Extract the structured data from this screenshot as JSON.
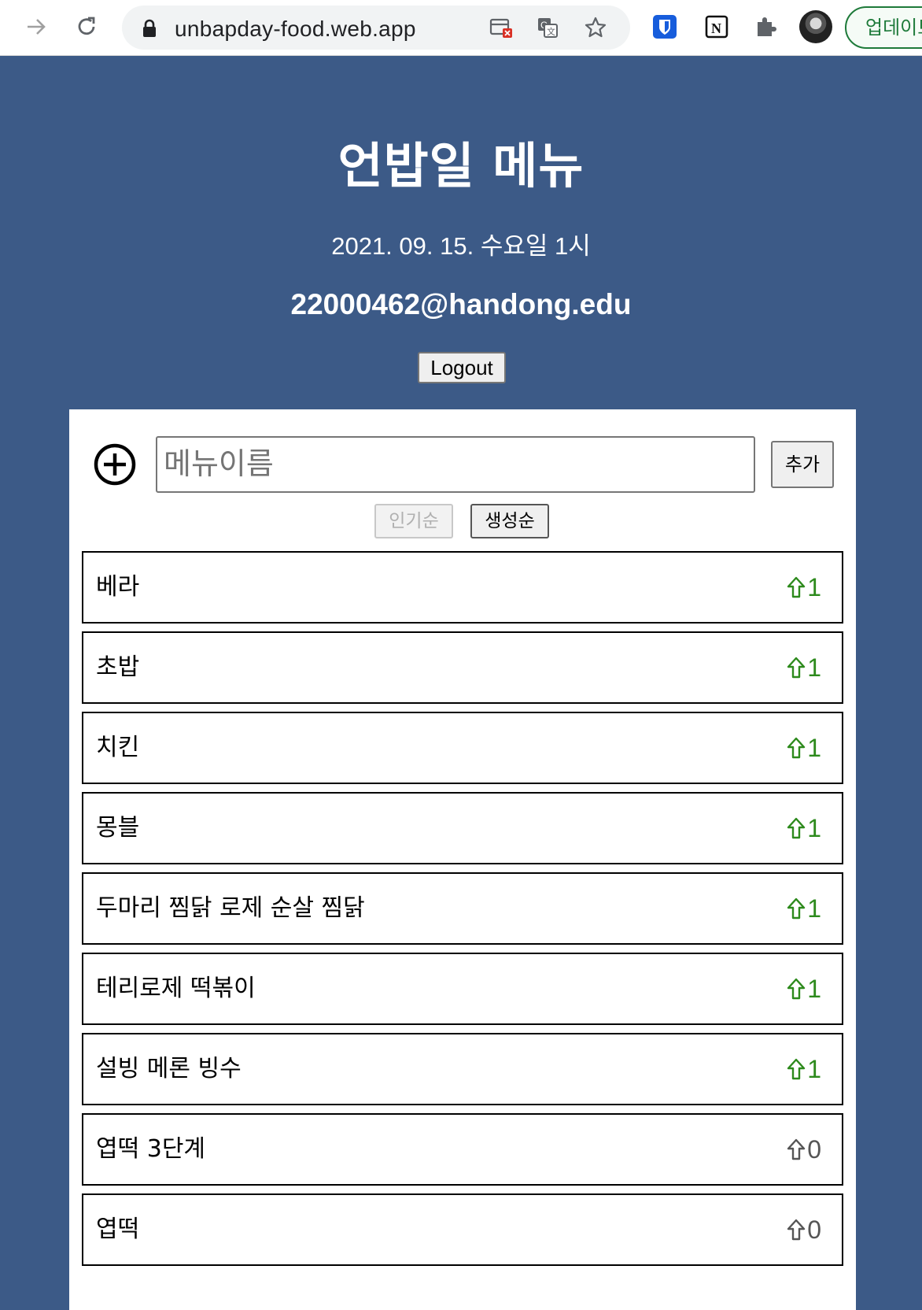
{
  "browser": {
    "url": "unbapday-food.web.app",
    "update_label": "업데이트"
  },
  "header": {
    "title": "언밥일 메뉴",
    "datetime": "2021. 09. 15. 수요일 1시",
    "email": "22000462@handong.edu",
    "logout_label": "Logout"
  },
  "form": {
    "placeholder": "메뉴이름",
    "add_label": "추가"
  },
  "sort": {
    "popular_label": "인기순",
    "newest_label": "생성순"
  },
  "menu_items": [
    {
      "name": "베라",
      "votes": "1",
      "voted": true
    },
    {
      "name": "초밥",
      "votes": "1",
      "voted": true
    },
    {
      "name": "치킨",
      "votes": "1",
      "voted": true
    },
    {
      "name": "몽블",
      "votes": "1",
      "voted": true
    },
    {
      "name": "두마리 찜닭 로제 순살 찜닭",
      "votes": "1",
      "voted": true
    },
    {
      "name": "테리로제 떡볶이",
      "votes": "1",
      "voted": true
    },
    {
      "name": "설빙 메론 빙수",
      "votes": "1",
      "voted": true
    },
    {
      "name": "엽떡 3단계",
      "votes": "0",
      "voted": false
    },
    {
      "name": "엽떡",
      "votes": "0",
      "voted": false
    }
  ],
  "colors": {
    "header_bg": "#3c5a87",
    "voted": "#2d8a1c",
    "unvoted": "#555555"
  }
}
